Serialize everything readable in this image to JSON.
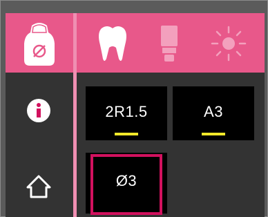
{
  "sidebar": {
    "items": [
      {
        "name": "device-mode",
        "icon": "seal-device-icon"
      },
      {
        "name": "info",
        "icon": "info-icon"
      },
      {
        "name": "home",
        "icon": "home-icon"
      }
    ]
  },
  "toolbar": {
    "items": [
      {
        "name": "tooth",
        "icon": "tooth-icon",
        "state": "active"
      },
      {
        "name": "tip",
        "icon": "tip-icon",
        "state": "inactive"
      },
      {
        "name": "light",
        "icon": "sun-icon",
        "state": "inactive"
      }
    ]
  },
  "tiles": {
    "shade_1": {
      "label": "2R1.5"
    },
    "shade_2": {
      "label": "A3"
    },
    "diameter": {
      "label": "Ø3"
    }
  },
  "colors": {
    "accent": "#e8588a",
    "selection": "#d2115e",
    "indicator": "#f2e82a",
    "panel": "#333333",
    "tile": "#000000"
  }
}
